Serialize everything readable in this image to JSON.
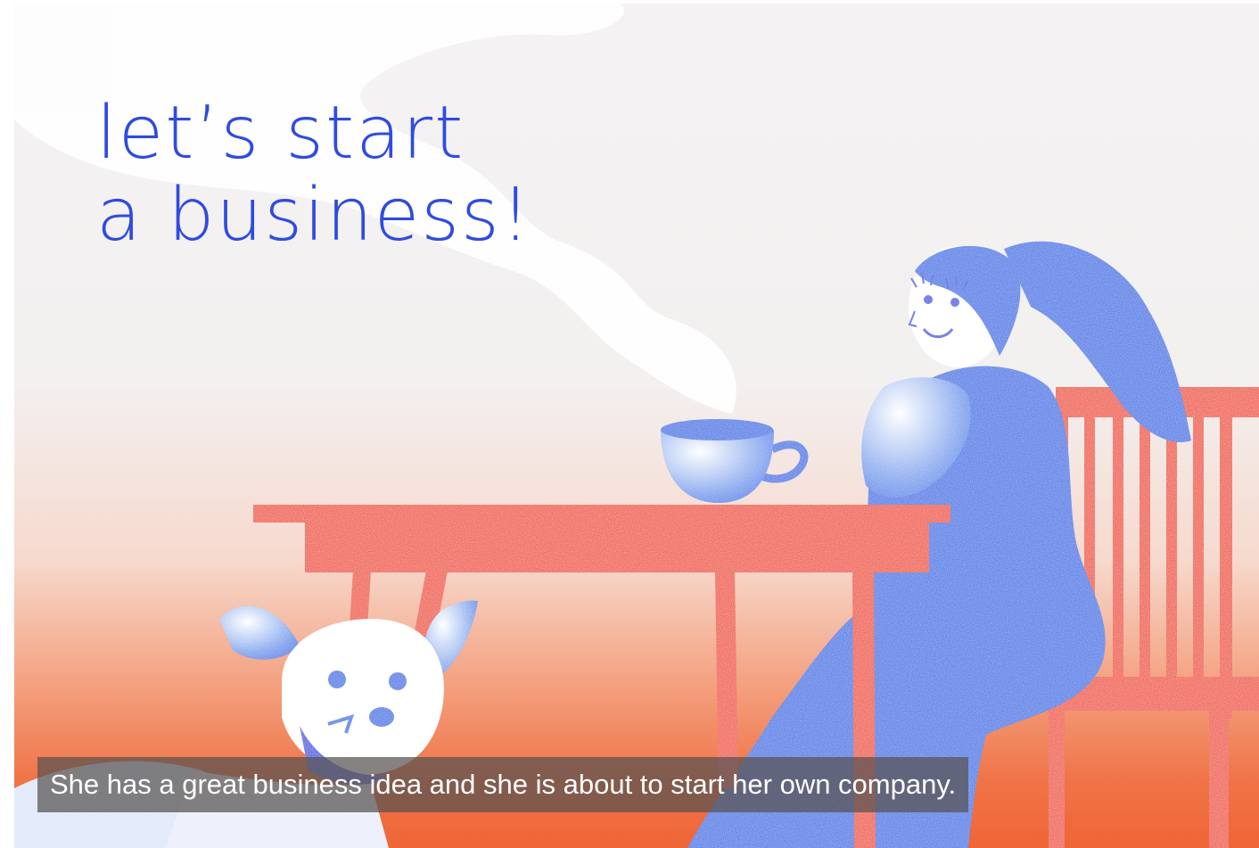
{
  "title": {
    "line1": "let’s start",
    "line2": "a business!"
  },
  "caption": "She has a great business idea and she is about to start her own company.",
  "colors": {
    "title": "#2f4be0",
    "figure_blue": "#2f6fe6",
    "furniture_red": "#ef4423",
    "caption_bg": "#58524f"
  },
  "icons": [
    "woman-figure",
    "dog",
    "coffee-cup",
    "table",
    "chair",
    "steam"
  ]
}
